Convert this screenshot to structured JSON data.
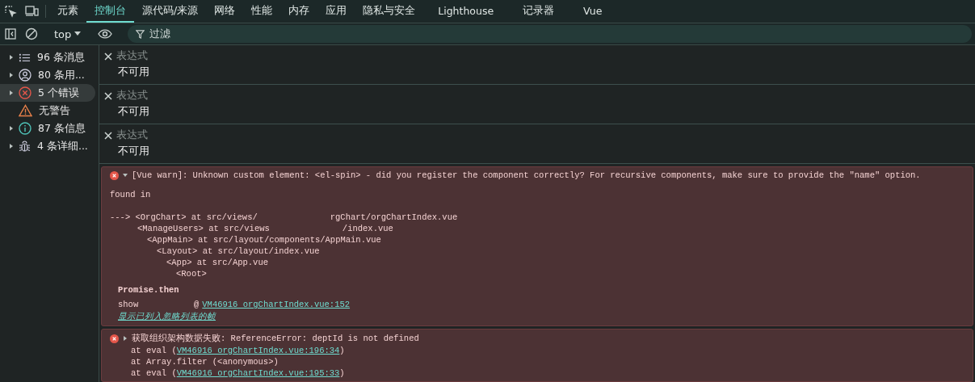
{
  "tabs": [
    {
      "label": "元素",
      "selected": false
    },
    {
      "label": "控制台",
      "selected": true
    },
    {
      "label": "源代码/来源",
      "selected": false
    },
    {
      "label": "网络",
      "selected": false
    },
    {
      "label": "性能",
      "selected": false
    },
    {
      "label": "内存",
      "selected": false
    },
    {
      "label": "应用",
      "selected": false
    },
    {
      "label": "隐私与安全",
      "selected": false
    },
    {
      "label": "Lighthouse",
      "selected": false
    },
    {
      "label": "记录器",
      "selected": false
    },
    {
      "label": "Vue",
      "selected": false
    }
  ],
  "toolbar": {
    "context": "top",
    "filter_placeholder": "过滤"
  },
  "sidebar": {
    "items": [
      {
        "kind": "list",
        "label": "96 条消息",
        "expandable": true,
        "selected": false
      },
      {
        "kind": "user",
        "label": "80 条用...",
        "expandable": true,
        "selected": false
      },
      {
        "kind": "error",
        "label": "5 个错误",
        "expandable": true,
        "selected": true
      },
      {
        "kind": "warning",
        "label": "无警告",
        "expandable": false,
        "selected": false
      },
      {
        "kind": "info",
        "label": "87 条信息",
        "expandable": true,
        "selected": false
      },
      {
        "kind": "bug",
        "label": "4 条详细...",
        "expandable": true,
        "selected": false
      }
    ]
  },
  "expressions": [
    {
      "placeholder": "表达式",
      "value": "不可用"
    },
    {
      "placeholder": "表达式",
      "value": "不可用"
    },
    {
      "placeholder": "表达式",
      "value": "不可用"
    }
  ],
  "messages": [
    {
      "expanded": true,
      "text": "[Vue warn]: Unknown custom element: <el-spin> - did you register the component correctly? For recursive components, make sure to provide the \"name\" option.",
      "found_in": "found in",
      "trace": [
        {
          "parts": [
            "---> <OrgChart> at src/views/",
            "rgChart/orgChartIndex.vue"
          ]
        },
        {
          "parts": [
            "<ManageUsers> at src/views",
            "/index.vue"
          ]
        },
        {
          "parts": [
            "<AppMain> at src/layout/components/AppMain.vue"
          ]
        },
        {
          "parts": [
            "<Layout> at src/layout/index.vue"
          ]
        },
        {
          "parts": [
            "<App> at src/App.vue"
          ]
        },
        {
          "parts": [
            "<Root>"
          ]
        }
      ],
      "async_label": "Promise.then",
      "frames": [
        {
          "name": "show",
          "at": "@",
          "link": "VM46916 orgChartIndex.vue:152"
        }
      ],
      "ignored_link": "显示已列入忽略列表的帧"
    },
    {
      "expanded": false,
      "text": "获取组织架构数据失败: ReferenceError: deptId is not defined",
      "stack": [
        {
          "prefix": "at eval (",
          "link": "VM46916 orgChartIndex.vue:196:34",
          "suffix": ")"
        },
        {
          "prefix": "at Array.filter (<anonymous>)"
        },
        {
          "prefix": "at eval (",
          "link": "VM46916 orgChartIndex.vue:195:33",
          "suffix": ")"
        }
      ]
    }
  ]
}
